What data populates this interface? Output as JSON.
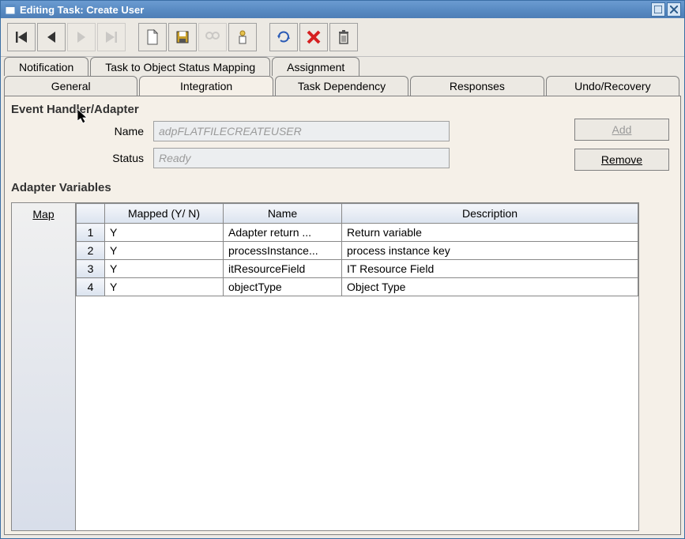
{
  "window": {
    "title": "Editing Task: Create User"
  },
  "tabs_top": [
    {
      "label": "Notification"
    },
    {
      "label": "Task to Object Status Mapping"
    },
    {
      "label": "Assignment"
    }
  ],
  "tabs_bottom": [
    {
      "label": "General"
    },
    {
      "label": "Integration"
    },
    {
      "label": "Task Dependency"
    },
    {
      "label": "Responses"
    },
    {
      "label": "Undo/Recovery"
    }
  ],
  "section1": {
    "title": "Event Handler/Adapter",
    "name_label": "Name",
    "name_value": "adpFLATFILECREATEUSER",
    "status_label": "Status",
    "status_value": "Ready",
    "add_label": "Add",
    "remove_label": "Remove"
  },
  "section2": {
    "title": "Adapter Variables",
    "map_label": "Map",
    "columns": {
      "mapped": "Mapped (Y/ N)",
      "name": "Name",
      "description": "Description"
    },
    "rows": [
      {
        "n": "1",
        "mapped": "Y",
        "name": "Adapter return ...",
        "description": "Return variable"
      },
      {
        "n": "2",
        "mapped": "Y",
        "name": "processInstance...",
        "description": "process instance key"
      },
      {
        "n": "3",
        "mapped": "Y",
        "name": "itResourceField",
        "description": "IT Resource Field"
      },
      {
        "n": "4",
        "mapped": "Y",
        "name": "objectType",
        "description": "Object Type"
      }
    ]
  },
  "icons": {
    "first": "first-icon",
    "prev": "prev-icon",
    "next": "next-icon",
    "last": "last-icon",
    "new": "new-doc-icon",
    "save": "save-icon",
    "find": "binoculars-icon",
    "task": "task-icon",
    "refresh": "refresh-icon",
    "delete": "x-icon",
    "trash": "trash-icon"
  }
}
